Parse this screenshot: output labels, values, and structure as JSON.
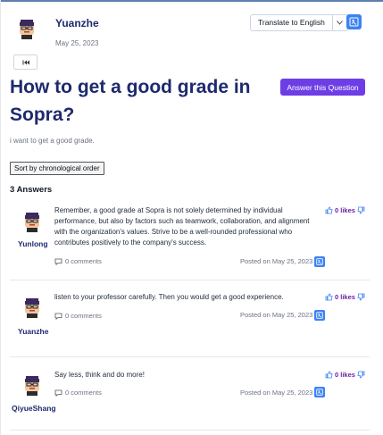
{
  "question": {
    "author": "Yuanzhe",
    "date": "May 25, 2023",
    "title": "How to get a good grade in Sopra?",
    "body": "i want to get a good grade.",
    "answer_button": "Answer this Question"
  },
  "toolbar": {
    "translate_label": "Translate to English",
    "sort_label": "Sort by chronological order",
    "answers_count": "3 Answers"
  },
  "answers": [
    {
      "author": "Yunlong",
      "text": "Remember, a good grade at Sopra is not solely determined by individual performance, but also by factors such as teamwork, collaboration, and alignment with the organization's values. Strive to be a well-rounded professional who contributes positively to the company's success.",
      "likes": "0 likes",
      "comments": "0 comments",
      "posted": "Posted on May 25, 2023"
    },
    {
      "author": "Yuanzhe",
      "text": "listen to your professor carefully. Then you would get a good experience.",
      "likes": "0 likes",
      "comments": "0 comments",
      "posted": "Posted on May 25, 2023"
    },
    {
      "author": "QiyueShang",
      "text": "Say less, think and do more!",
      "likes": "0 likes",
      "comments": "0 comments",
      "posted": "Posted on May 25, 2023"
    }
  ],
  "colors": {
    "title": "#1e2a6e",
    "primary_button": "#6d3ee6",
    "icon_blue": "#3b82f6",
    "likes": "#6b21a8"
  },
  "icons": [
    "avatar-icon",
    "chevron-down-icon",
    "translate-icon",
    "back-icon",
    "thumbs-up-icon",
    "thumbs-down-icon",
    "comment-icon"
  ]
}
